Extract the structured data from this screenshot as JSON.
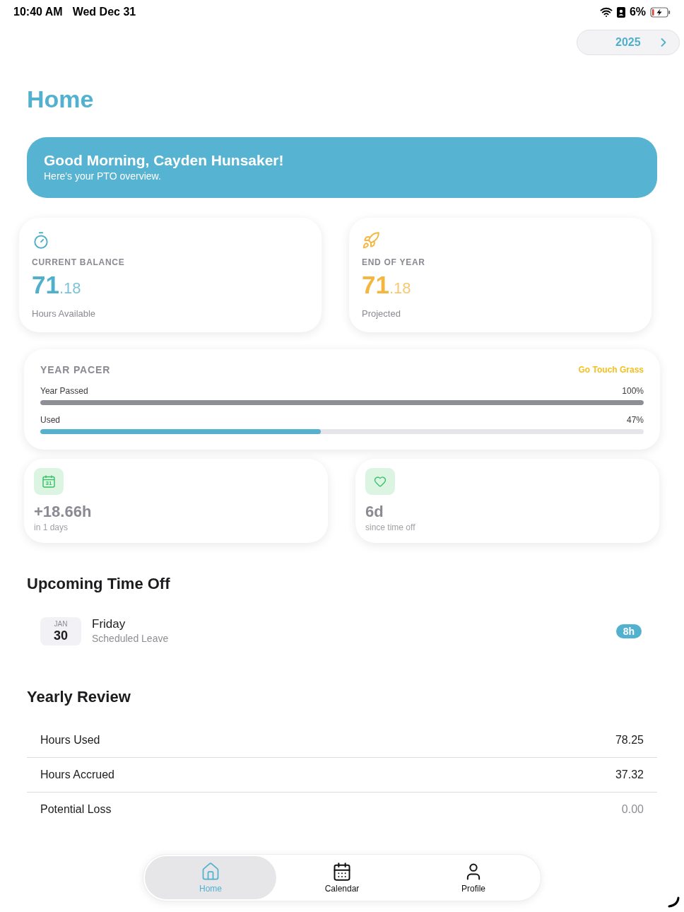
{
  "status_bar": {
    "time": "10:40 AM",
    "date": "Wed Dec 31",
    "battery": "6%"
  },
  "year_selector": {
    "label": "2025"
  },
  "title": "Home",
  "greeting": {
    "title": "Good Morning, Cayden Hunsaker!",
    "subtitle": "Here's your PTO overview."
  },
  "stat_cards": [
    {
      "kind": "balance",
      "label": "CURRENT BALANCE",
      "whole": "71",
      "fraction": ".18",
      "caption": "Hours Available",
      "color": "#4fb0cc"
    },
    {
      "kind": "projection",
      "label": "END OF YEAR",
      "whole": "71",
      "fraction": ".18",
      "caption": "Projected",
      "color": "#f4b63f"
    }
  ],
  "year_pacer": {
    "title": "YEAR PACER",
    "status": "Go Touch Grass",
    "bars": [
      {
        "label": "Year Passed",
        "reading": "100%",
        "level": 1.0,
        "color": "#8e8e96"
      },
      {
        "label": "Used",
        "reading": "47%",
        "level": 0.465,
        "color": "#55b1cd"
      }
    ]
  },
  "mini_cards": [
    {
      "kind": "calendar",
      "icon_text": "31",
      "value": "+18.66h",
      "caption": "in 1 days"
    },
    {
      "kind": "heart",
      "value": "6d",
      "caption": "since time off"
    }
  ],
  "upcoming": {
    "title": "Upcoming Time Off",
    "items": [
      {
        "month": "JAN",
        "day": "30",
        "weekday": "Friday",
        "type": "Scheduled Leave",
        "hours": "8h"
      }
    ]
  },
  "yearly_review": {
    "title": "Yearly Review",
    "rows": [
      {
        "label": "Hours Used",
        "value": "78.25",
        "muted": false
      },
      {
        "label": "Hours Accrued",
        "value": "37.32",
        "muted": false
      },
      {
        "label": "Potential Loss",
        "value": "0.00",
        "muted": true
      }
    ]
  },
  "tab_bar": [
    {
      "kind": "home",
      "label": "Home",
      "selected": true
    },
    {
      "kind": "calendar",
      "label": "Calendar",
      "selected": false
    },
    {
      "kind": "profile",
      "label": "Profile",
      "selected": false
    }
  ]
}
